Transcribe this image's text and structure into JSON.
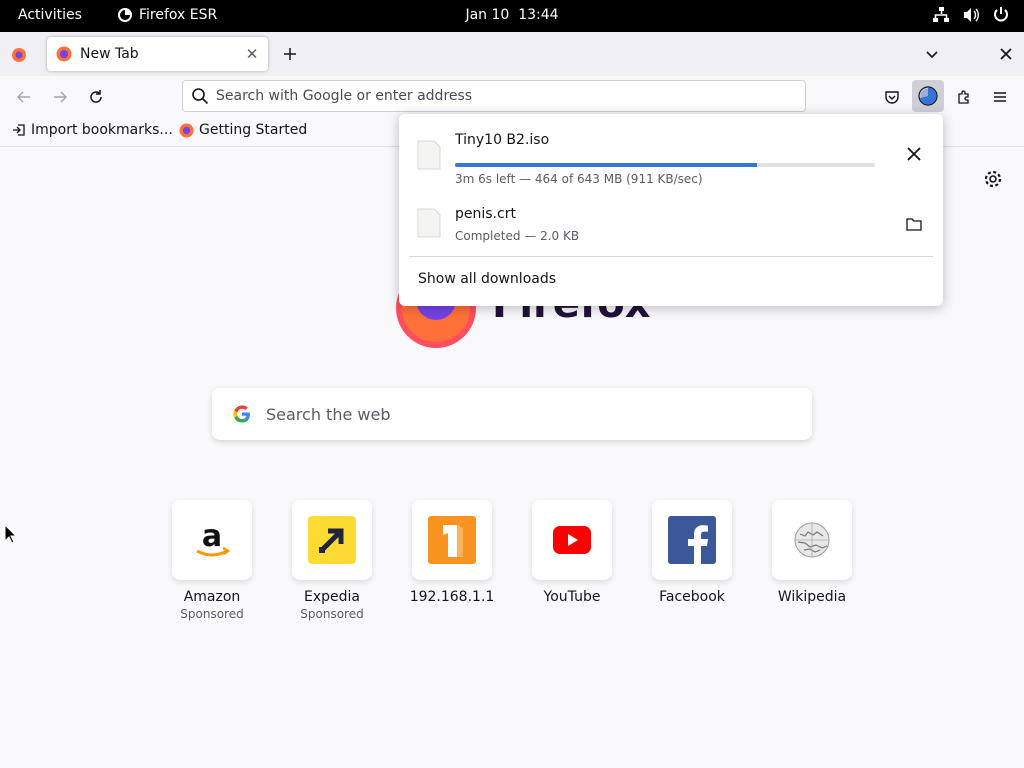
{
  "system_bar": {
    "activities": "Activities",
    "app_name": "Firefox ESR",
    "date": "Jan 10",
    "time": "13:44"
  },
  "tabs": [
    {
      "title": "New Tab",
      "active": true
    }
  ],
  "urlbar": {
    "placeholder": "Search with Google or enter address",
    "value": ""
  },
  "bookmarks": [
    {
      "label": "Import bookmarks..."
    },
    {
      "label": "Getting Started"
    }
  ],
  "newtab": {
    "search_placeholder": "Search the web",
    "logo_word": "Firefox",
    "tiles": [
      {
        "label": "Amazon",
        "sponsored": "Sponsored",
        "icon": "amazon-icon"
      },
      {
        "label": "Expedia",
        "sponsored": "Sponsored",
        "icon": "expedia-icon"
      },
      {
        "label": "192.168.1.1",
        "sponsored": "",
        "icon": "orange-1-icon"
      },
      {
        "label": "YouTube",
        "sponsored": "",
        "icon": "youtube-icon"
      },
      {
        "label": "Facebook",
        "sponsored": "",
        "icon": "facebook-icon"
      },
      {
        "label": "Wikipedia",
        "sponsored": "",
        "icon": "wikipedia-icon"
      }
    ]
  },
  "downloads": {
    "items": [
      {
        "name": "Tiny10 B2.iso",
        "status": "3m 6s left — 464 of 643 MB (911 KB/sec)",
        "progress": 0.72,
        "action": "cancel"
      },
      {
        "name": "penis.crt",
        "status": "Completed — 2.0 KB",
        "action": "open-folder"
      }
    ],
    "show_all": "Show all downloads"
  },
  "colors": {
    "accent": "#3776d6",
    "topbar": "#000000",
    "toolbar": "#f9f9fb",
    "tabstrip": "#f0f0f4"
  }
}
